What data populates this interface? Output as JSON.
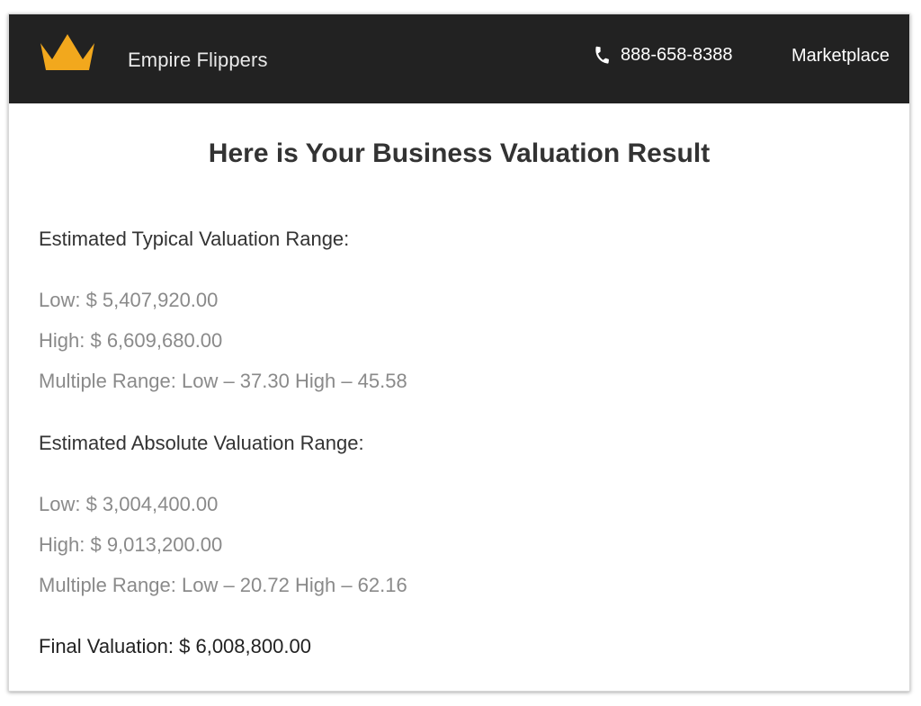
{
  "header": {
    "brand": "Empire Flippers",
    "phone": "888-658-8388",
    "nav_marketplace": "Marketplace",
    "logo_color": "#f2a81d",
    "background": "#222222"
  },
  "main": {
    "title": "Here is Your Business Valuation Result",
    "typical": {
      "heading": "Estimated Typical Valuation Range:",
      "low": "Low: $ 5,407,920.00",
      "high": "High: $ 6,609,680.00",
      "multiple": "Multiple Range: Low – 37.30 High – 45.58"
    },
    "absolute": {
      "heading": "Estimated Absolute Valuation Range:",
      "low": "Low: $ 3,004,400.00",
      "high": "High: $ 9,013,200.00",
      "multiple": "Multiple Range: Low – 20.72 High – 62.16"
    },
    "final": "Final Valuation: $ 6,008,800.00"
  }
}
